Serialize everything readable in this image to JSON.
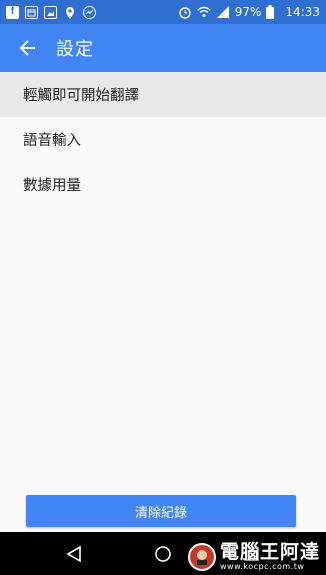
{
  "status_bar": {
    "notification_icons": [
      "facebook-icon",
      "calendar-icon",
      "gallery-icon",
      "location-icon",
      "messenger-icon"
    ],
    "battery": "97%",
    "time": "14:33"
  },
  "app_bar": {
    "title": "設定"
  },
  "settings": {
    "items": [
      {
        "label": "輕觸即可開始翻譯"
      },
      {
        "label": "語音輸入"
      },
      {
        "label": "數據用量"
      }
    ]
  },
  "actions": {
    "clear_history_label": "清除紀錄"
  },
  "watermark": {
    "title": "電腦王阿達",
    "url": "www.kocpc.com.tw"
  },
  "colors": {
    "status_bar": "#2f6fd1",
    "app_bar": "#4285f4",
    "button": "#4285f4",
    "selected_item": "#e8e8e8"
  }
}
